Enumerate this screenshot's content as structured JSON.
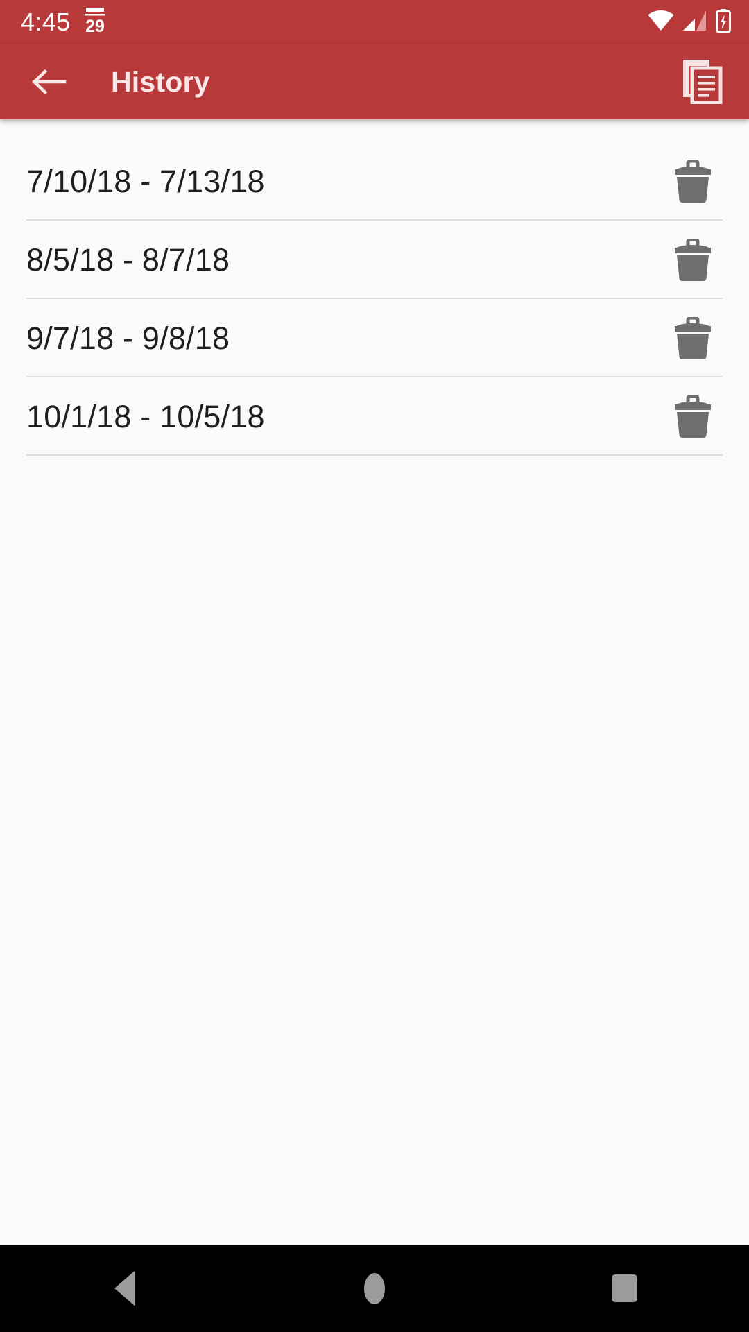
{
  "theme": {
    "primary": "#b8393a",
    "page_background": "#fafafa",
    "divider": "#dcdcdc",
    "text_primary": "#1f1f1f",
    "appbar_text": "#fae7e7",
    "icon_gray": "#6e6e6e",
    "nav_icon": "#9b9b9b",
    "nav_background": "#000000"
  },
  "status_bar": {
    "clock": "4:45",
    "notification_icons": [
      "calendar-29-icon"
    ],
    "calendar_day": "29",
    "system_icons": [
      "wifi-icon",
      "cellular-signal-icon",
      "battery-charging-icon"
    ]
  },
  "app_bar": {
    "back_label": "Navigate up",
    "title": "History",
    "action_label": "Copy"
  },
  "history": {
    "rows": [
      {
        "range": "7/10/18 - 7/13/18",
        "delete_label": "Delete"
      },
      {
        "range": "8/5/18 - 8/7/18",
        "delete_label": "Delete"
      },
      {
        "range": "9/7/18 - 9/8/18",
        "delete_label": "Delete"
      },
      {
        "range": "10/1/18 - 10/5/18",
        "delete_label": "Delete"
      }
    ]
  },
  "nav_bar": {
    "back_label": "Back",
    "home_label": "Home",
    "recents_label": "Recents"
  }
}
